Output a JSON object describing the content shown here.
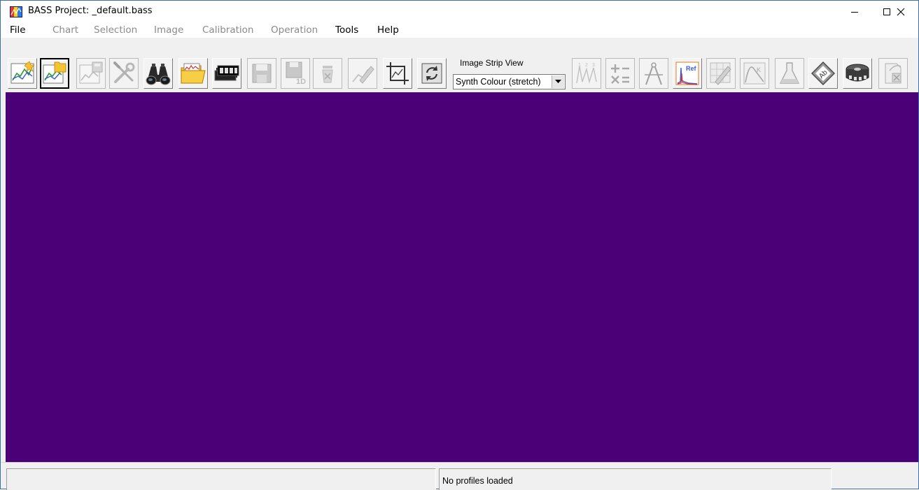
{
  "window": {
    "title": "BASS Project: _default.bass"
  },
  "menu": {
    "file": "File",
    "chart": "Chart",
    "selection": "Selection",
    "image": "Image",
    "calibration": "Calibration",
    "operation": "Operation",
    "tools": "Tools",
    "help": "Help"
  },
  "toolbar": {
    "strip_label": "Image Strip View",
    "strip_value": "Synth Colour (stretch)",
    "ref_text": "Ref",
    "ab_text": "Ab",
    "onedee_text": "1D"
  },
  "status": {
    "left": "",
    "right": "No profiles loaded"
  },
  "colors": {
    "canvas": "#4b0078",
    "disabled_text": "#8a8a8a",
    "folder": "#f4c431"
  }
}
